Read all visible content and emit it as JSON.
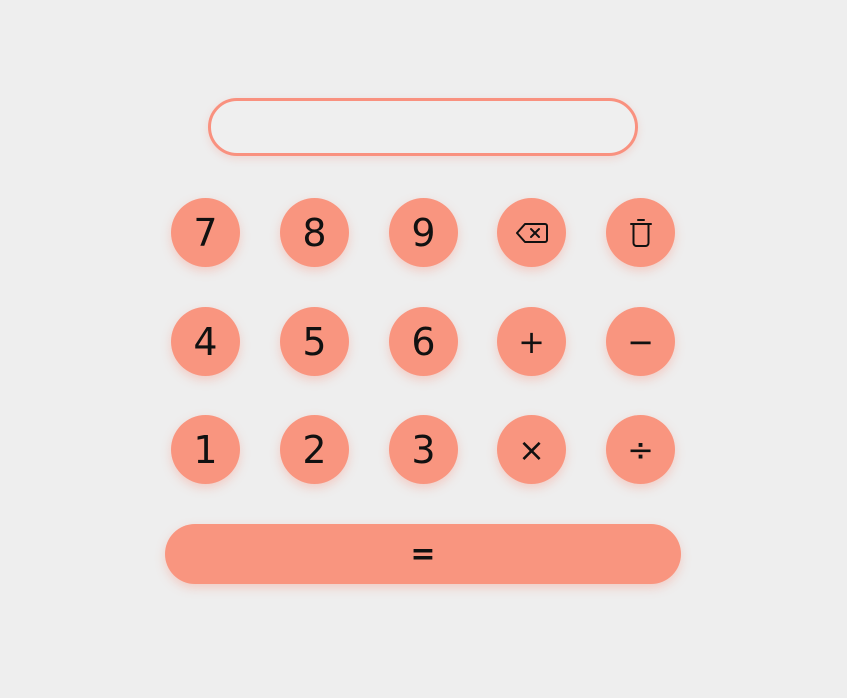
{
  "display": {
    "value": "",
    "placeholder": ""
  },
  "keys": {
    "seven": "7",
    "eight": "8",
    "nine": "9",
    "backspace_icon": "backspace-icon",
    "clear_icon": "trash-icon",
    "four": "4",
    "five": "5",
    "six": "6",
    "plus": "+",
    "minus": "−",
    "one": "1",
    "two": "2",
    "three": "3",
    "multiply": "×",
    "divide": "÷",
    "equals": "="
  },
  "colors": {
    "background": "#eeeeee",
    "accent": "#f9957f",
    "text": "#111111"
  }
}
